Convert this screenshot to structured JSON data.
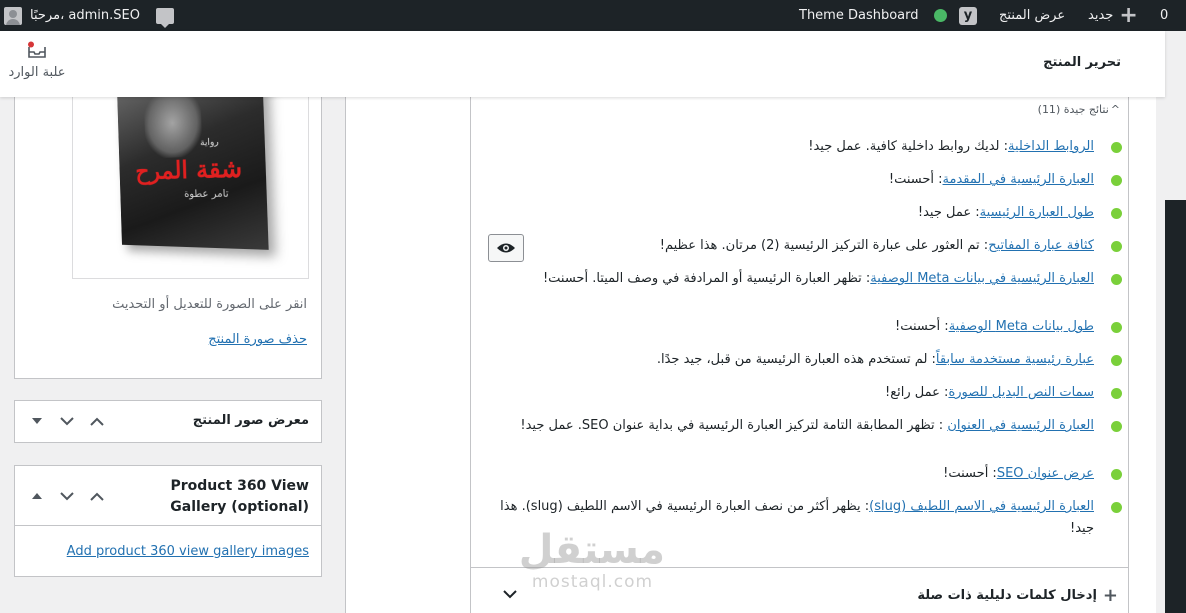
{
  "adminbar": {
    "updates_count": "0",
    "new_label": "جديد",
    "view_product": "عرض المنتج",
    "theme_dashboard": "Theme Dashboard",
    "greeting": "مرحبًا، admin.SEO"
  },
  "header": {
    "title": "تحرير المنتج",
    "inbox_label": "علبة الوارد"
  },
  "product_image": {
    "book_title": "شقة المرح",
    "book_genre": "رواية",
    "book_author": "تامر عطوة",
    "hint": "انقر على الصورة للتعديل أو التحديث",
    "remove_link": "حذف صورة المنتج"
  },
  "gallery_box": {
    "title": "معرض صور المنتج"
  },
  "p360_box": {
    "title_line1": "Product 360 View",
    "title_line2": "Gallery (optional)",
    "link": "Add product 360 view gallery images"
  },
  "seo": {
    "good_results_header": "نتائج جيدة (11)",
    "results": [
      {
        "link": "الروابط الداخلية",
        "text": ": لديك روابط داخلية كافية. عمل جيد!"
      },
      {
        "link": "العبارة الرئيسية في المقدمة",
        "text": ": أحسنت!"
      },
      {
        "link": "طول العبارة الرئيسية",
        "text": ": عمل جيد!"
      },
      {
        "link": "كثافة عبارة المفاتيح",
        "text": ": تم العثور على عبارة التركيز الرئيسية (2) مرتان. هذا عظيم!"
      },
      {
        "link": "العبارة الرئيسية في بيانات Meta الوصفية",
        "text": ": تظهر العبارة الرئيسية أو المرادفة في وصف الميتا. أحسنت!"
      },
      {
        "link": "طول بيانات Meta الوصفية",
        "text": ": أحسنت!"
      },
      {
        "link": "عبارة رئيسية مستخدمة سابقاً",
        "text": ": لم تستخدم هذه العبارة الرئيسية من قبل، جيد جدًا."
      },
      {
        "link": "سمات النص البديل للصورة",
        "text": ": عمل رائع!"
      },
      {
        "link": "العبارة الرئيسية في العنوان",
        "text": " : تظهر المطابقة التامة لتركيز العبارة الرئيسية في بداية عنوان SEO. عمل جيد!"
      },
      {
        "link": "عرض عنوان SEO",
        "text": ": أحسنت!"
      },
      {
        "link": "العبارة الرئيسية في الاسم اللطيف (slug)",
        "text": ": يظهر أكثر من نصف العبارة الرئيسية في الاسم اللطيف (slug). هذا جيد!"
      }
    ],
    "related_keywords": "إدخال كلمات دليلية ذات صلة"
  },
  "watermark": {
    "arabic": "مستقل",
    "latin": "mostaql.com"
  },
  "colors": {
    "good": "#7ad03a",
    "link": "#2271b1",
    "adminbar": "#1d2327"
  }
}
